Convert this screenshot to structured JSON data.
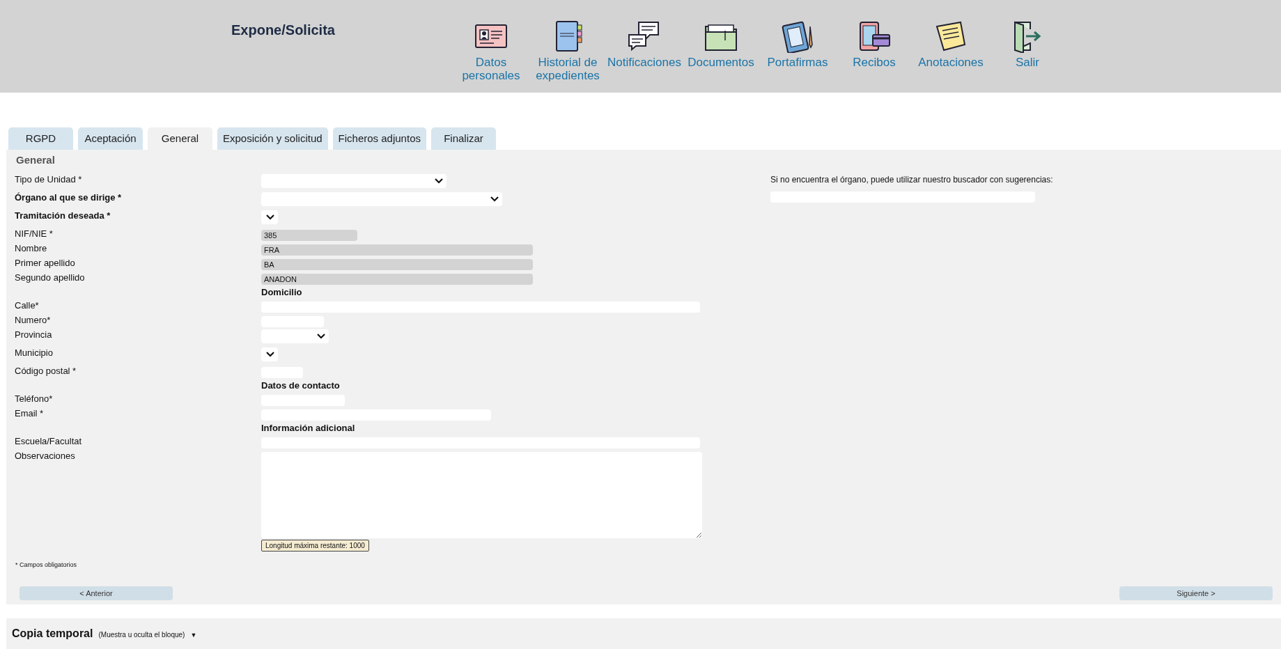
{
  "header": {
    "title": "Expone/Solicita",
    "nav": [
      {
        "label": "Datos personales"
      },
      {
        "label": "Historial de expedientes"
      },
      {
        "label": "Notificaciones"
      },
      {
        "label": "Documentos"
      },
      {
        "label": "Portafirmas"
      },
      {
        "label": "Recibos"
      },
      {
        "label": "Anotaciones"
      },
      {
        "label": "Salir"
      }
    ]
  },
  "tabs": [
    {
      "label": "RGPD",
      "selected": false
    },
    {
      "label": "Aceptación",
      "selected": false
    },
    {
      "label": "General",
      "selected": true
    },
    {
      "label": "Exposición y solicitud",
      "selected": false
    },
    {
      "label": "Ficheros adjuntos",
      "selected": false
    },
    {
      "label": "Finalizar",
      "selected": false
    }
  ],
  "form": {
    "heading": "General",
    "fields": [
      {
        "kind": "select",
        "label": "Tipo de Unidad *",
        "bold": false
      },
      {
        "kind": "select",
        "label": "Órgano al que se dirige *",
        "bold": true
      },
      {
        "kind": "select",
        "label": "Tramitación deseada *",
        "bold": true
      },
      {
        "kind": "readonly",
        "label": "NIF/NIE *",
        "bold": false,
        "value": "385"
      },
      {
        "kind": "readonly",
        "label": "Nombre",
        "bold": false,
        "value": "FRA"
      },
      {
        "kind": "readonly",
        "label": "Primer apellido",
        "bold": false,
        "value": "BA"
      },
      {
        "kind": "readonly",
        "label": "Segundo apellido",
        "bold": false,
        "value": "ANADON"
      },
      {
        "kind": "section",
        "label": "Domicilio"
      },
      {
        "kind": "input",
        "label": "Calle*",
        "bold": false
      },
      {
        "kind": "input",
        "label": "Numero*",
        "bold": false
      },
      {
        "kind": "select",
        "label": "Provincia",
        "bold": false
      },
      {
        "kind": "select",
        "label": "Municipio",
        "bold": false
      },
      {
        "kind": "input",
        "label": "Código postal *",
        "bold": false
      },
      {
        "kind": "section",
        "label": "Datos de contacto"
      },
      {
        "kind": "input",
        "label": "Teléfono*",
        "bold": false
      },
      {
        "kind": "input",
        "label": "Email *",
        "bold": false
      },
      {
        "kind": "section",
        "label": "Información adicional"
      },
      {
        "kind": "input",
        "label": "Escuela/Facultat",
        "bold": false
      },
      {
        "kind": "textarea",
        "label": "Observaciones",
        "bold": false,
        "counter": "Longitud máxima restante: 1000"
      }
    ],
    "note": "* Campos obligatorios",
    "previous_button": "< Anterior",
    "next_button": "Siguiente >"
  },
  "suggestion": {
    "text": "Si no encuentra el órgano, puede utilizar nuestro buscador con sugerencias:"
  },
  "temporary_copy": {
    "title": "Copia temporal",
    "hint": "(Muestra u oculta el bloque)",
    "caret": "▼"
  }
}
